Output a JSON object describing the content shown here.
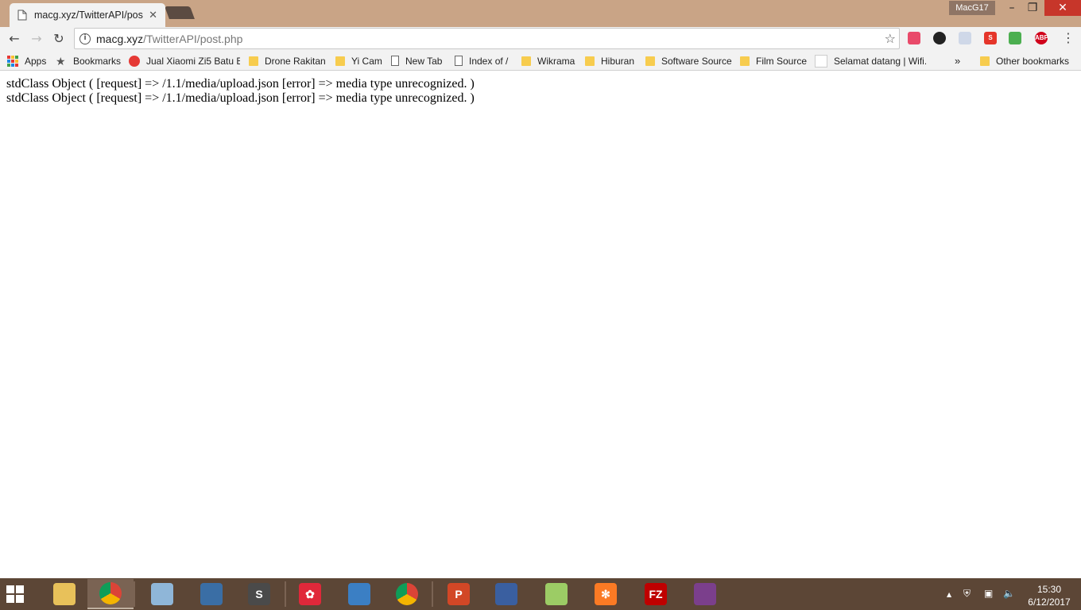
{
  "window": {
    "tab_title": "macg.xyz/TwitterAPI/pos",
    "tab_close": "✕",
    "profile_name": "MacG17",
    "minimize": "–",
    "restore": "❐",
    "close": "✕"
  },
  "toolbar": {
    "back": "←",
    "forward": "→",
    "reload": "↻",
    "url_host": "macg.xyz",
    "url_path": "/TwitterAPI/post.php",
    "star": "☆",
    "menu": "⋮",
    "extensions": [
      {
        "name": "heart-extension-icon",
        "color": "#e94a6a"
      },
      {
        "name": "camera-extension-icon",
        "color": "#222222"
      },
      {
        "name": "blank-extension-icon",
        "color": "#cfd8e8"
      },
      {
        "name": "s-extension-icon",
        "color": "#e5352a",
        "label": "S"
      },
      {
        "name": "stripes-extension-icon",
        "color": "#4caf50"
      },
      {
        "name": "abp-extension-icon",
        "color": "#d0021b",
        "label": "ABP"
      }
    ]
  },
  "bookmarks": {
    "apps": "Apps",
    "bookmarks": "Bookmarks",
    "items": [
      {
        "label": "Jual Xiaomi Zi5 Batu B",
        "type": "site"
      },
      {
        "label": "Drone Rakitan",
        "type": "folder"
      },
      {
        "label": "Yi Cam",
        "type": "folder"
      },
      {
        "label": "New Tab",
        "type": "page"
      },
      {
        "label": "Index of /",
        "type": "page"
      },
      {
        "label": "Wikrama",
        "type": "folder"
      },
      {
        "label": "Hiburan",
        "type": "folder"
      },
      {
        "label": "Software Source",
        "type": "folder"
      },
      {
        "label": "Film Source",
        "type": "folder"
      },
      {
        "label": "Selamat datang | Wifi.",
        "type": "white"
      }
    ],
    "overflow": "»",
    "other": "Other bookmarks"
  },
  "page": {
    "lines": [
      "stdClass Object ( [request] => /1.1/media/upload.json [error] => media type unrecognized. )",
      "stdClass Object ( [request] => /1.1/media/upload.json [error] => media type unrecognized. )"
    ]
  },
  "taskbar": {
    "apps": [
      {
        "name": "file-explorer-taskbar-icon",
        "color": "#e8c15a",
        "glyph": ""
      },
      {
        "name": "chrome-taskbar-icon",
        "color": "#4285f4",
        "glyph": "",
        "active": true
      },
      {
        "name": "paint-taskbar-icon",
        "color": "#8fb6d8",
        "glyph": ""
      },
      {
        "name": "remote-taskbar-icon",
        "color": "#3a6ea5",
        "glyph": ""
      },
      {
        "name": "sublime-taskbar-icon",
        "color": "#4a4a4a",
        "glyph": "S"
      },
      {
        "name": "flower-app-taskbar-icon",
        "color": "#e0283a",
        "glyph": "✿"
      },
      {
        "name": "wifi-app-taskbar-icon",
        "color": "#3b7fc4",
        "glyph": ""
      },
      {
        "name": "chrome-second-taskbar-icon",
        "color": "#4285f4",
        "glyph": ""
      },
      {
        "name": "powerpoint-taskbar-icon",
        "color": "#d24726",
        "glyph": "P"
      },
      {
        "name": "network-tool-taskbar-icon",
        "color": "#3a5fa0",
        "glyph": ""
      },
      {
        "name": "notes-taskbar-icon",
        "color": "#9ccc65",
        "glyph": ""
      },
      {
        "name": "xampp-taskbar-icon",
        "color": "#fb7a24",
        "glyph": "✻"
      },
      {
        "name": "filezilla-taskbar-icon",
        "color": "#bf0000",
        "glyph": "FZ"
      },
      {
        "name": "winrar-taskbar-icon",
        "color": "#7b3f8c",
        "glyph": ""
      }
    ],
    "tray_up": "▲",
    "time": "15:30",
    "date": "6/12/2017"
  }
}
